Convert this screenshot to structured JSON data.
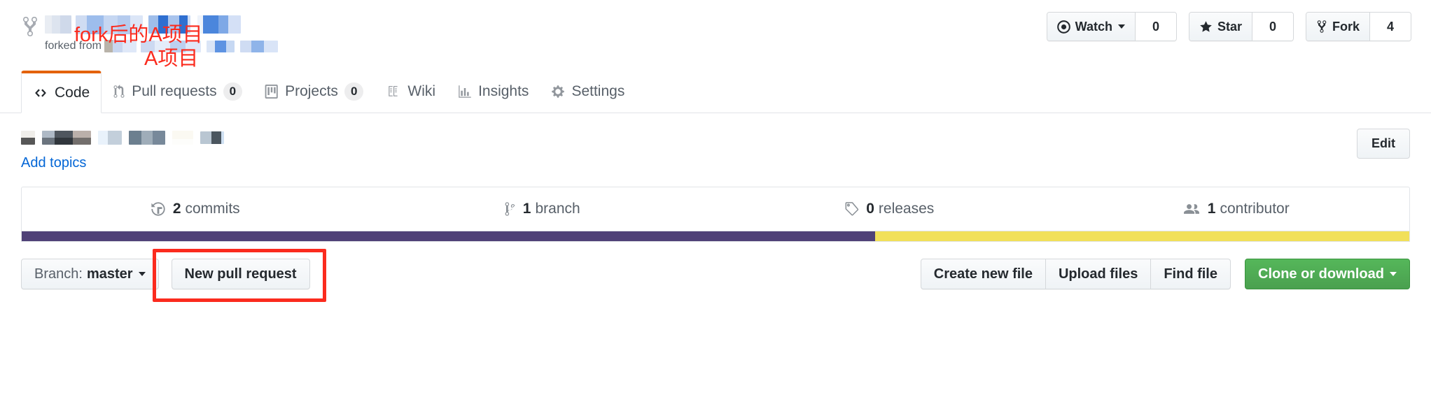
{
  "header": {
    "fork_icon": "repo-forked-icon",
    "forked_from_label": "forked from",
    "annotations": [
      {
        "text": "fork后的A项目",
        "color": "#fb2b1e"
      },
      {
        "text": "A项目",
        "color": "#fb2b1e"
      }
    ],
    "actions": [
      {
        "name": "watch",
        "icon": "eye-icon",
        "label": "Watch",
        "count": "0",
        "has_caret": true
      },
      {
        "name": "star",
        "icon": "star-icon",
        "label": "Star",
        "count": "0",
        "has_caret": false
      },
      {
        "name": "fork",
        "icon": "repo-forked-icon",
        "label": "Fork",
        "count": "4",
        "has_caret": false
      }
    ]
  },
  "tabs": [
    {
      "label": "Code",
      "icon": "code-icon",
      "count": null,
      "active": true
    },
    {
      "label": "Pull requests",
      "icon": "git-pull-request-icon",
      "count": "0",
      "active": false
    },
    {
      "label": "Projects",
      "icon": "project-board-icon",
      "count": "0",
      "active": false
    },
    {
      "label": "Wiki",
      "icon": "book-icon",
      "count": null,
      "active": false
    },
    {
      "label": "Insights",
      "icon": "graph-icon",
      "count": null,
      "active": false
    },
    {
      "label": "Settings",
      "icon": "gear-icon",
      "count": null,
      "active": false
    }
  ],
  "meta": {
    "add_topics_label": "Add topics",
    "edit_label": "Edit"
  },
  "stats": [
    {
      "icon": "history-icon",
      "value": "2",
      "label": "commits"
    },
    {
      "icon": "git-branch-icon",
      "value": "1",
      "label": "branch"
    },
    {
      "icon": "tag-icon",
      "value": "0",
      "label": "releases"
    },
    {
      "icon": "people-icon",
      "value": "1",
      "label": "contributor"
    }
  ],
  "languages": [
    {
      "name": "language-primary",
      "color": "#4f4177",
      "percent": 61.5
    },
    {
      "name": "language-secondary",
      "color": "#f1e05a",
      "percent": 38.5
    }
  ],
  "toolbar": {
    "branch_prefix": "Branch:",
    "branch_name": "master",
    "new_pull_request_label": "New pull request",
    "create_new_file_label": "Create new file",
    "upload_files_label": "Upload files",
    "find_file_label": "Find file",
    "clone_label": "Clone or download"
  }
}
